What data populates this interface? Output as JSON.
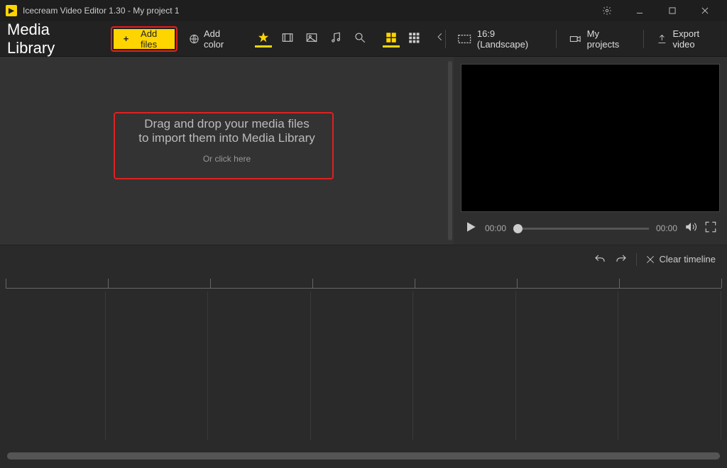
{
  "titlebar": {
    "title": "Icecream Video Editor 1.30 - My project 1"
  },
  "toolbar": {
    "section_title": "Media Library",
    "add_files_label": "Add files",
    "add_color_label": "Add color",
    "aspect_label": "16:9 (Landscape)",
    "my_projects_label": "My projects",
    "export_label": "Export video"
  },
  "dropzone": {
    "line1": "Drag and drop your media files",
    "line2": "to import them into Media Library",
    "line3": "Or click here"
  },
  "player": {
    "time_current": "00:00",
    "time_total": "00:00"
  },
  "timeline": {
    "clear_label": "Clear timeline"
  }
}
